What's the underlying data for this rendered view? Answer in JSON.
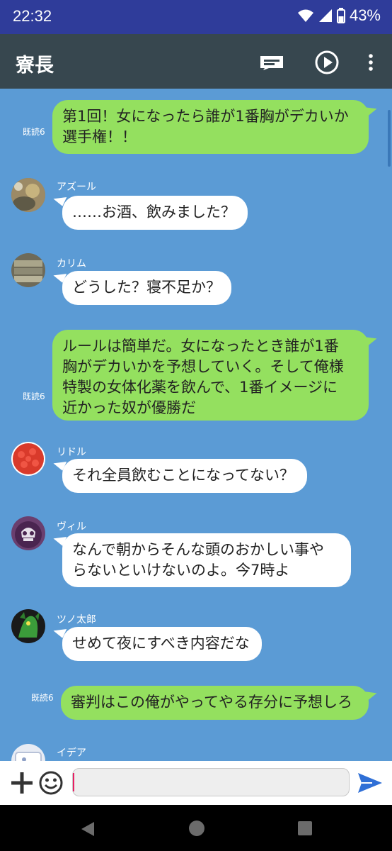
{
  "status": {
    "time": "22:32",
    "battery": "43%"
  },
  "header": {
    "title": "寮長",
    "icons": [
      "message-icon",
      "play-circle-icon",
      "more-vert-icon"
    ]
  },
  "messages": [
    {
      "type": "out",
      "read": "既読6",
      "lines": [
        "第1回！女になったら誰が1番胸がデカいか",
        "選手権！！"
      ]
    },
    {
      "type": "in",
      "name": "アズール",
      "lines": [
        "……お酒、飲みました？"
      ]
    },
    {
      "type": "in",
      "name": "カリム",
      "lines": [
        "どうした？寝不足か？"
      ]
    },
    {
      "type": "out",
      "read": "既読6",
      "lines": [
        "ルールは簡単だ。女になったとき誰が1番",
        "胸がデカいかを予想していく。そして俺様",
        "特製の女体化薬を飲んで、1番イメージに",
        "近かった奴が優勝だ"
      ]
    },
    {
      "type": "in",
      "name": "リドル",
      "lines": [
        "それ全員飲むことになってない？"
      ]
    },
    {
      "type": "in",
      "name": "ヴィル",
      "lines": [
        "なんで朝からそんな頭のおかしい事や",
        "らないといけないのよ。今7時よ"
      ]
    },
    {
      "type": "in",
      "name": "ツノ太郎",
      "lines": [
        "せめて夜にすべき内容だな"
      ]
    },
    {
      "type": "out",
      "read": "既読6",
      "lines": [
        "審判はこの俺がやってやる存分に予想しろ"
      ]
    },
    {
      "type": "in",
      "name": "イデア",
      "lines": []
    }
  ],
  "input": {
    "placeholder": "",
    "value": ""
  },
  "colors": {
    "chat_bg": "#5b9bd5",
    "out_bubble": "#94e05f",
    "in_bubble": "#ffffff",
    "app_bar": "#37474f",
    "status_bar": "#2f3c9a",
    "send": "#2f6fd6"
  }
}
